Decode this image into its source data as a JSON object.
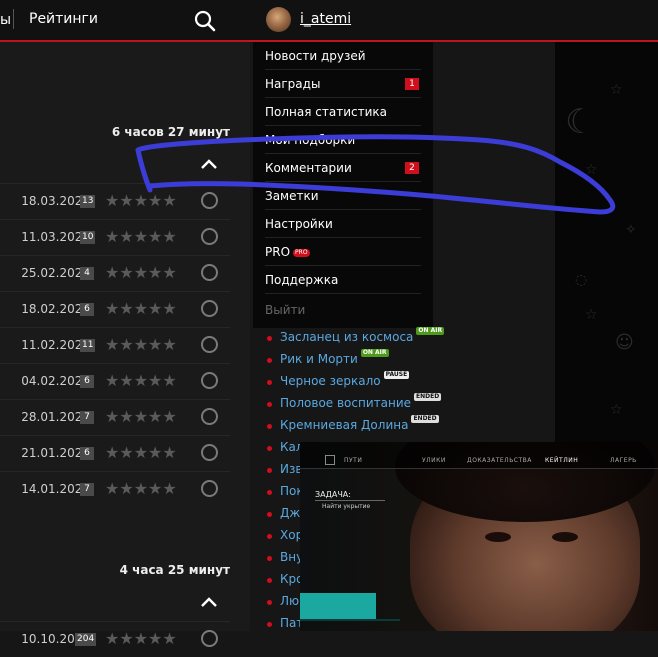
{
  "header": {
    "nav_cut_label": "ы",
    "nav_ratings_label": "Рейтинги",
    "search_icon": "search-icon",
    "username": "i_atemi"
  },
  "menu": {
    "items": [
      {
        "label": "Новости друзей",
        "badge": ""
      },
      {
        "label": "Награды",
        "badge": "1"
      },
      {
        "label": "Полная статистика",
        "badge": ""
      },
      {
        "label": "Мои подборки",
        "badge": ""
      },
      {
        "label": "Комментарии",
        "badge": "2"
      },
      {
        "label": "Заметки",
        "badge": ""
      },
      {
        "label": "Настройки",
        "badge": ""
      },
      {
        "label": "PRO",
        "badge": "",
        "pro_badge": "PRO"
      },
      {
        "label": "Поддержка",
        "badge": ""
      },
      {
        "label": "Выйти",
        "badge": ""
      }
    ]
  },
  "seasons": [
    {
      "time_label": "6 часов 27 минут",
      "episodes": [
        {
          "date": "18.03.2025",
          "comments": "13"
        },
        {
          "date": "11.03.2025",
          "comments": "10"
        },
        {
          "date": "25.02.2025",
          "comments": "4"
        },
        {
          "date": "18.02.2025",
          "comments": "6"
        },
        {
          "date": "11.02.2025",
          "comments": "11"
        },
        {
          "date": "04.02.2025",
          "comments": "6"
        },
        {
          "date": "28.01.2025",
          "comments": "7"
        },
        {
          "date": "21.01.2025",
          "comments": "6"
        },
        {
          "date": "14.01.2025",
          "comments": "7"
        }
      ]
    },
    {
      "time_label": "4 часа 25 минут",
      "episodes": [
        {
          "date": "10.10.2024",
          "comments": "204"
        }
      ]
    }
  ],
  "stars_glyph": "★★★★★",
  "shows": [
    {
      "title": "Засланец из космоса",
      "status": "ON AIR",
      "status_type": "on"
    },
    {
      "title": "Рик и Морти",
      "status": "ON AIR",
      "status_type": "on"
    },
    {
      "title": "Черное зеркало",
      "status": "PAUSE",
      "status_type": "pause"
    },
    {
      "title": "Половое воспитание",
      "status": "ENDED",
      "status_type": "end"
    },
    {
      "title": "Кремниевая Долина",
      "status": "ENDED",
      "status_type": "end"
    },
    {
      "title": "Кал",
      "status": "",
      "status_type": ""
    },
    {
      "title": "Изв",
      "status": "",
      "status_type": ""
    },
    {
      "title": "Пок",
      "status": "",
      "status_type": ""
    },
    {
      "title": "Дж",
      "status": "",
      "status_type": ""
    },
    {
      "title": "Хор",
      "status": "",
      "status_type": ""
    },
    {
      "title": "Вну",
      "status": "",
      "status_type": ""
    },
    {
      "title": "Кро",
      "status": "",
      "status_type": ""
    },
    {
      "title": "Лю",
      "status": "",
      "status_type": ""
    },
    {
      "title": "Пат",
      "status": "",
      "status_type": ""
    }
  ],
  "video": {
    "tabs": [
      "ПУТИ",
      "УЛИКИ",
      "ДОКАЗАТЕЛЬСТВА",
      "КЕЙТЛИН",
      "ЛАГЕРЬ"
    ],
    "active_tab": "КЕЙТЛИН",
    "task_title": "ЗАДАЧА:",
    "task_item": "Найти укрытие"
  },
  "colors": {
    "accent_red": "#c0141c",
    "link_blue": "#5aa8e0",
    "scribble_blue": "#3c3cd6",
    "on_air_green": "#4e9a1a"
  }
}
